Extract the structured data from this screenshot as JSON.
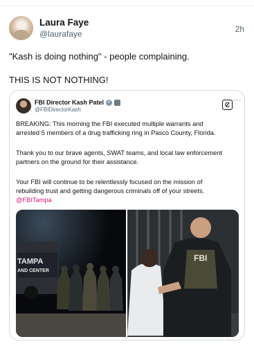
{
  "author": {
    "name": "Laura Faye",
    "handle": "@laurafaye",
    "time": "2h"
  },
  "post": {
    "line1": "\"Kash is doing nothing\" - people complaining.",
    "line2": "THIS IS NOT NOTHING!"
  },
  "quoted": {
    "name": "FBI Director Kash Patel",
    "handle": "@FBIDirectorKash",
    "text_lines": [
      "BREAKING: This morning the FBI executed multiple warrants and",
      "arrested 5 members of a drug trafficking ring in Pasco County, Florida.",
      "",
      "Thank you to our brave agents, SWAT teams, and local law enforcement",
      "partners on the ground for their assistance.",
      "",
      "Your FBI will continue to be relentlessly focused on the mission of",
      "rebuilding trust and getting dangerous criminals off of your streets."
    ],
    "mention": "@FBITampa",
    "image_left_text": [
      "TAMPA",
      "AND CENTER"
    ],
    "image_right_text": "FBI"
  },
  "icons": {
    "verified": "verified-badge-icon",
    "flag": "affiliation-flag-icon",
    "grok": "grok-icon",
    "more": "more-options-icon"
  },
  "colors": {
    "mention": "#d81b7a",
    "secondary_text": "#536471",
    "border": "#cfd9de"
  }
}
